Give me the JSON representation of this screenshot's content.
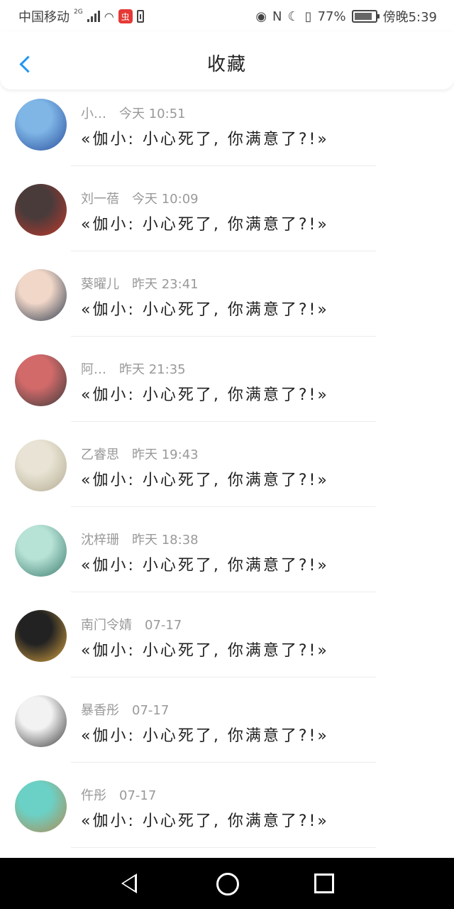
{
  "status_bar": {
    "carrier": "中国移动",
    "network": "2G",
    "app_badge": "虫",
    "battery": "77%",
    "battery_level": 0.77,
    "time": "傍晚5:39"
  },
  "header": {
    "title": "收藏"
  },
  "favorites": [
    {
      "name": "小…",
      "time": "今天 10:51",
      "message": "«伽小: 小心死了, 你满意了?!»",
      "avatar_colors": [
        "#7fb6e6",
        "#2a4f9e"
      ]
    },
    {
      "name": "刘一蓓",
      "time": "今天 10:09",
      "message": "«伽小: 小心死了, 你满意了?!»",
      "avatar_colors": [
        "#4a3b3b",
        "#c0392b"
      ]
    },
    {
      "name": "葵曜儿",
      "time": "昨天 23:41",
      "message": "«伽小: 小心死了, 你满意了?!»",
      "avatar_colors": [
        "#f1d7c8",
        "#2e3b4e"
      ]
    },
    {
      "name": "阿…",
      "time": "昨天 21:35",
      "message": "«伽小: 小心死了, 你满意了?!»",
      "avatar_colors": [
        "#d36a6a",
        "#3a3a3a"
      ]
    },
    {
      "name": "乙睿思",
      "time": "昨天 19:43",
      "message": "«伽小: 小心死了, 你满意了?!»",
      "avatar_colors": [
        "#e8e3d4",
        "#b3ab92"
      ]
    },
    {
      "name": "沈梓珊",
      "time": "昨天 18:38",
      "message": "«伽小: 小心死了, 你满意了?!»",
      "avatar_colors": [
        "#b7e3d6",
        "#3c7b6e"
      ]
    },
    {
      "name": "南门令婧",
      "time": "07-17",
      "message": "«伽小: 小心死了, 你满意了?!»",
      "avatar_colors": [
        "#222222",
        "#d9a441"
      ]
    },
    {
      "name": "暴香彤",
      "time": "07-17",
      "message": "«伽小: 小心死了, 你满意了?!»",
      "avatar_colors": [
        "#f2f2f2",
        "#3a3a3a"
      ]
    },
    {
      "name": "仵彤",
      "time": "07-17",
      "message": "«伽小: 小心死了, 你满意了?!»",
      "avatar_colors": [
        "#6bd1c6",
        "#b08a52"
      ]
    }
  ],
  "icons": {
    "back": "chevron-left-icon",
    "eye": "eye-icon",
    "nfc": "nfc-icon",
    "moon": "moon-icon",
    "vibrate": "vibrate-icon",
    "nav_back": "triangle-back-icon",
    "nav_home": "circle-home-icon",
    "nav_recent": "square-recent-icon"
  },
  "accent_color": "#2196F3"
}
